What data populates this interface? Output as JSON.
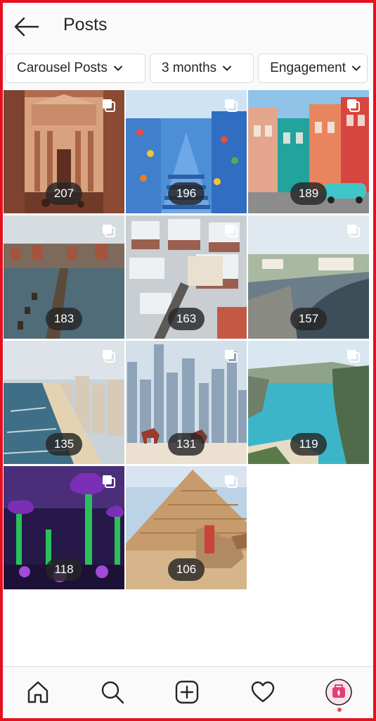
{
  "header": {
    "title": "Posts"
  },
  "filters": [
    {
      "label": "Carousel Posts"
    },
    {
      "label": "3 months"
    },
    {
      "label": "Engagement"
    }
  ],
  "posts": [
    {
      "count": "207",
      "scene": "petra"
    },
    {
      "count": "196",
      "scene": "blue-city"
    },
    {
      "count": "189",
      "scene": "havana"
    },
    {
      "count": "183",
      "scene": "prague"
    },
    {
      "count": "163",
      "scene": "snow-town"
    },
    {
      "count": "157",
      "scene": "coast-town"
    },
    {
      "count": "135",
      "scene": "beach-city"
    },
    {
      "count": "131",
      "scene": "dubai"
    },
    {
      "count": "119",
      "scene": "cove"
    },
    {
      "count": "118",
      "scene": "supertrees"
    },
    {
      "count": "106",
      "scene": "pyramids"
    }
  ],
  "tabs": [
    "home-icon",
    "search-icon",
    "new-post-icon",
    "activity-heart-icon",
    "profile-avatar-icon"
  ],
  "colors": {
    "frame": "#e5101f",
    "notification_dot": "#ed4956",
    "count_pill": "#262626"
  }
}
